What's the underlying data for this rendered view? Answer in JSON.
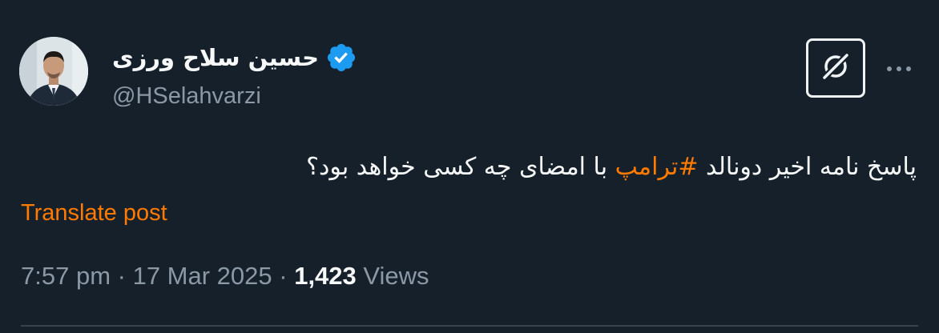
{
  "author": {
    "display_name": "حسین سلاح ورزی",
    "handle": "@HSelahvarzi",
    "verified": true
  },
  "icons": {
    "verified": "verified-badge-icon",
    "grok": "grok-slash-icon",
    "more": "more-horizontal-icon"
  },
  "post": {
    "text_before": "پاسخ نامه اخیر دونالد ",
    "hashtag": "#ترامپ",
    "text_after": " با امضای چه کسی خواهد بود؟"
  },
  "translate_label": "Translate post",
  "meta": {
    "time": "7:57 pm",
    "separator": " · ",
    "date": "17 Mar 2025",
    "views_count": "1,423",
    "views_label": "Views"
  },
  "colors": {
    "background": "#15202b",
    "accent": "#ff7a00",
    "verified": "#1d9bf0",
    "secondary_text": "#8b98a5"
  }
}
